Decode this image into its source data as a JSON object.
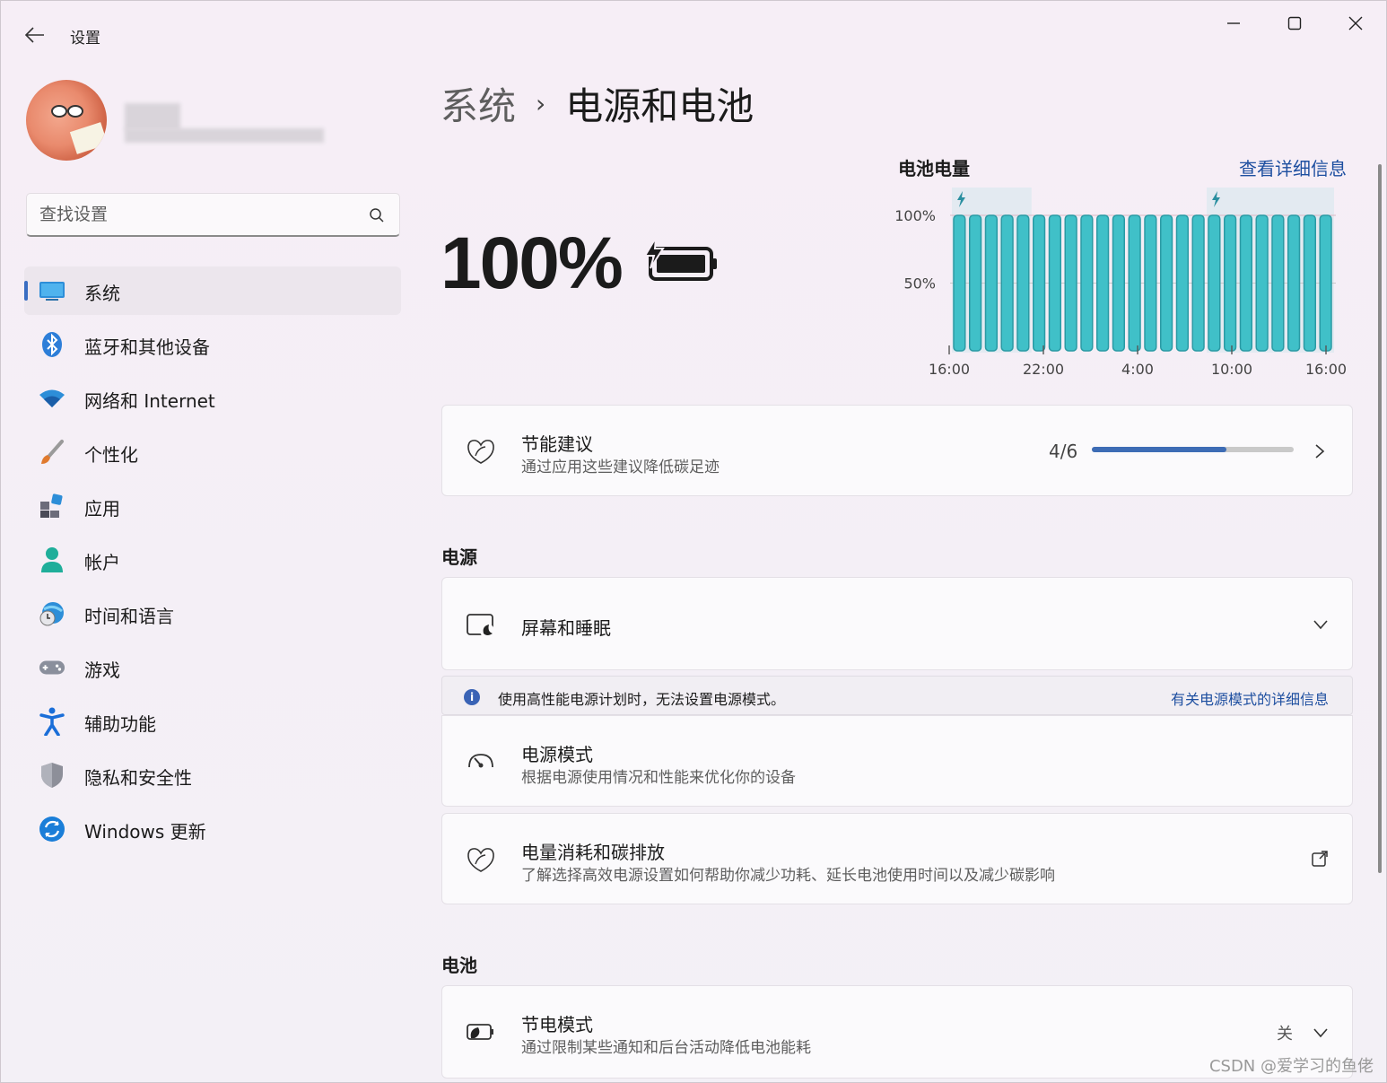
{
  "window": {
    "title": "设置",
    "controls": [
      "minimize",
      "maximize",
      "close"
    ]
  },
  "search": {
    "placeholder": "查找设置"
  },
  "sidebar": {
    "items": [
      {
        "label": "系统",
        "icon": "monitor-icon",
        "active": true
      },
      {
        "label": "蓝牙和其他设备",
        "icon": "bluetooth-icon"
      },
      {
        "label": "网络和 Internet",
        "icon": "wifi-icon"
      },
      {
        "label": "个性化",
        "icon": "brush-icon"
      },
      {
        "label": "应用",
        "icon": "apps-icon"
      },
      {
        "label": "帐户",
        "icon": "account-icon"
      },
      {
        "label": "时间和语言",
        "icon": "globe-clock-icon"
      },
      {
        "label": "游戏",
        "icon": "gamepad-icon"
      },
      {
        "label": "辅助功能",
        "icon": "accessibility-icon"
      },
      {
        "label": "隐私和安全性",
        "icon": "shield-icon"
      },
      {
        "label": "Windows 更新",
        "icon": "update-icon"
      }
    ]
  },
  "breadcrumb": {
    "parent": "系统",
    "separator": "›",
    "current": "电源和电池"
  },
  "battery": {
    "percent": "100%",
    "charging": true
  },
  "chart_data": {
    "type": "bar",
    "title": "电池电量",
    "link": "查看详细信息",
    "ytick_labels": [
      "100%",
      "50%"
    ],
    "xtick_labels": [
      "16:00",
      "22:00",
      "4:00",
      "10:00",
      "16:00"
    ],
    "ylim": [
      0,
      100
    ],
    "values": [
      100,
      100,
      100,
      100,
      100,
      100,
      100,
      100,
      100,
      100,
      100,
      100,
      100,
      100,
      100,
      100,
      100,
      100,
      100,
      100,
      100,
      100,
      100,
      100
    ],
    "charging_bars": [
      0,
      1,
      2,
      3,
      4,
      16,
      17,
      18,
      19,
      20,
      21,
      22,
      23
    ],
    "colors": {
      "bar": "#40c0c8",
      "bar_edge": "#2a9aa4",
      "charging_band": "#dce8f0"
    }
  },
  "energy_recommendations": {
    "title": "节能建议",
    "subtitle": "通过应用这些建议降低碳足迹",
    "progress_text": "4/6",
    "progress_fraction": 0.667
  },
  "power_section": {
    "heading": "电源",
    "screen_sleep": {
      "title": "屏幕和睡眠"
    },
    "notice": {
      "text": "使用高性能电源计划时，无法设置电源模式。",
      "link": "有关电源模式的详细信息"
    },
    "power_mode": {
      "title": "电源模式",
      "subtitle": "根据电源使用情况和性能来优化你的设备"
    },
    "carbon": {
      "title": "电量消耗和碳排放",
      "subtitle": "了解选择高效电源设置如何帮助你减少功耗、延长电池使用时间以及减少碳影响"
    }
  },
  "battery_section": {
    "heading": "电池",
    "saver": {
      "title": "节电模式",
      "subtitle": "通过限制某些通知和后台活动降低电池能耗",
      "state": "关"
    }
  },
  "watermark": "CSDN @爱学习的鱼佬",
  "colors": {
    "accent": "#3a6dc2",
    "link": "#1e4fa0"
  }
}
